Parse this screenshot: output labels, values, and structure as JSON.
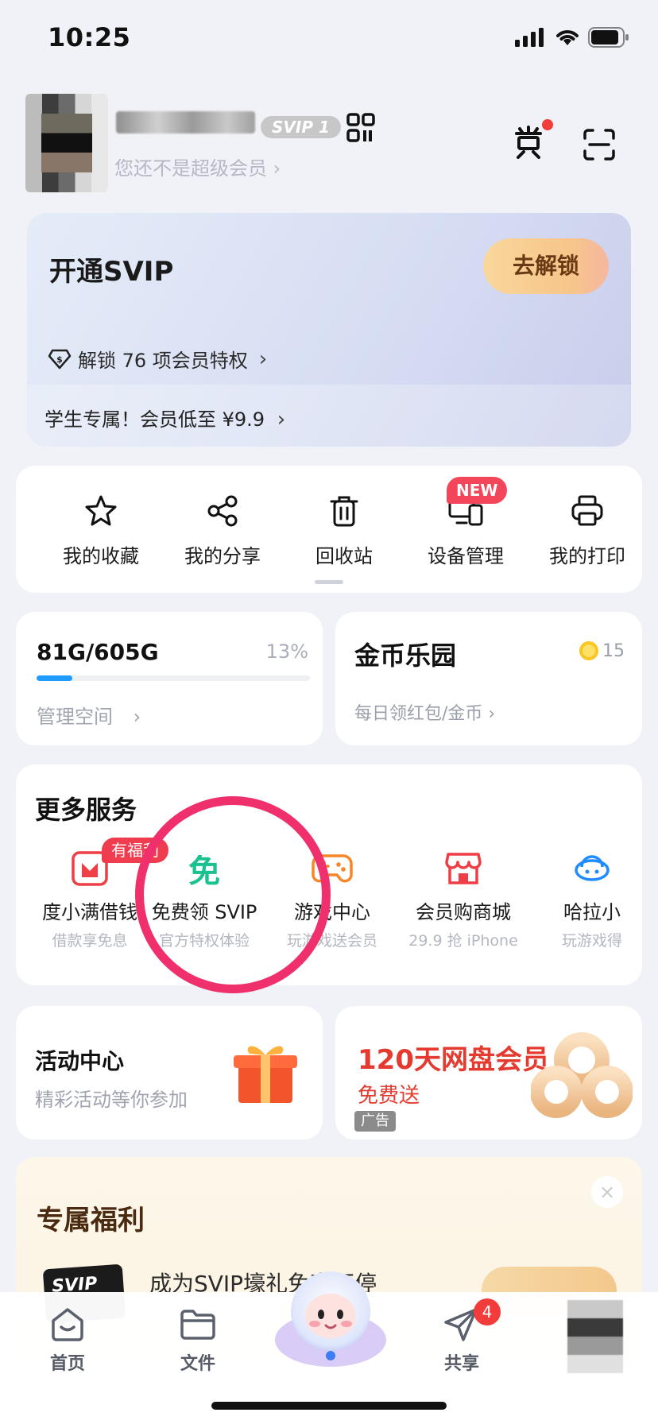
{
  "status_bar": {
    "time": "10:25"
  },
  "header": {
    "svip_badge": "SVIP 1",
    "not_member_text": "您还不是超级会员 ›"
  },
  "svip_card": {
    "title": "开通SVIP",
    "unlock_button": "去解锁",
    "privilege_text": "解锁 76 项会员特权",
    "student_text": "学生专属！会员低至 ¥9.9"
  },
  "tools": {
    "new_badge": "NEW",
    "items": [
      {
        "label": "我的收藏",
        "icon": "star-icon"
      },
      {
        "label": "我的分享",
        "icon": "share-icon"
      },
      {
        "label": "回收站",
        "icon": "trash-icon"
      },
      {
        "label": "设备管理",
        "icon": "device-icon"
      },
      {
        "label": "我的打印",
        "icon": "printer-icon"
      }
    ]
  },
  "storage": {
    "used": "81G/605G",
    "percent_label": "13%",
    "percent": 0.13,
    "manage_label": "管理空间",
    "chevron": "›"
  },
  "coins": {
    "title": "金币乐园",
    "count": "15",
    "subtitle": "每日领红包/金币 ›"
  },
  "services": {
    "title": "更多服务",
    "badge": "有福利",
    "items": [
      {
        "name": "度小满借钱",
        "sub": "借款享免息",
        "icon": "wallet-icon"
      },
      {
        "name": "免费领 SVIP",
        "sub": "官方特权体验",
        "icon": "free-svip-icon",
        "icon_text": "免"
      },
      {
        "name": "游戏中心",
        "sub": "玩游戏送会员",
        "icon": "gamepad-icon"
      },
      {
        "name": "会员购商城",
        "sub": "29.9 抢 iPhone",
        "icon": "store-icon"
      },
      {
        "name": "哈拉小",
        "sub": "玩游戏得",
        "icon": "hala-icon"
      }
    ]
  },
  "activity": {
    "title": "活动中心",
    "subtitle": "精彩活动等你参加"
  },
  "promo": {
    "title": "120天网盘会员",
    "subtitle": "免费送",
    "ad_tag": "广告"
  },
  "benefits": {
    "title": "专属福利",
    "card_text": "SVIP",
    "text": "成为SVIP壕礼免享不停",
    "close": "×"
  },
  "tabbar": {
    "items": [
      {
        "label": "首页",
        "icon": "home-icon"
      },
      {
        "label": "文件",
        "icon": "folder-icon"
      },
      {
        "label": "共享",
        "icon": "send-icon"
      }
    ],
    "share_badge": "4"
  },
  "colors": {
    "accent_blue": "#1e9cff",
    "highlight": "#f0306c",
    "promo_red": "#e43a2f",
    "free_green": "#19c28f"
  }
}
